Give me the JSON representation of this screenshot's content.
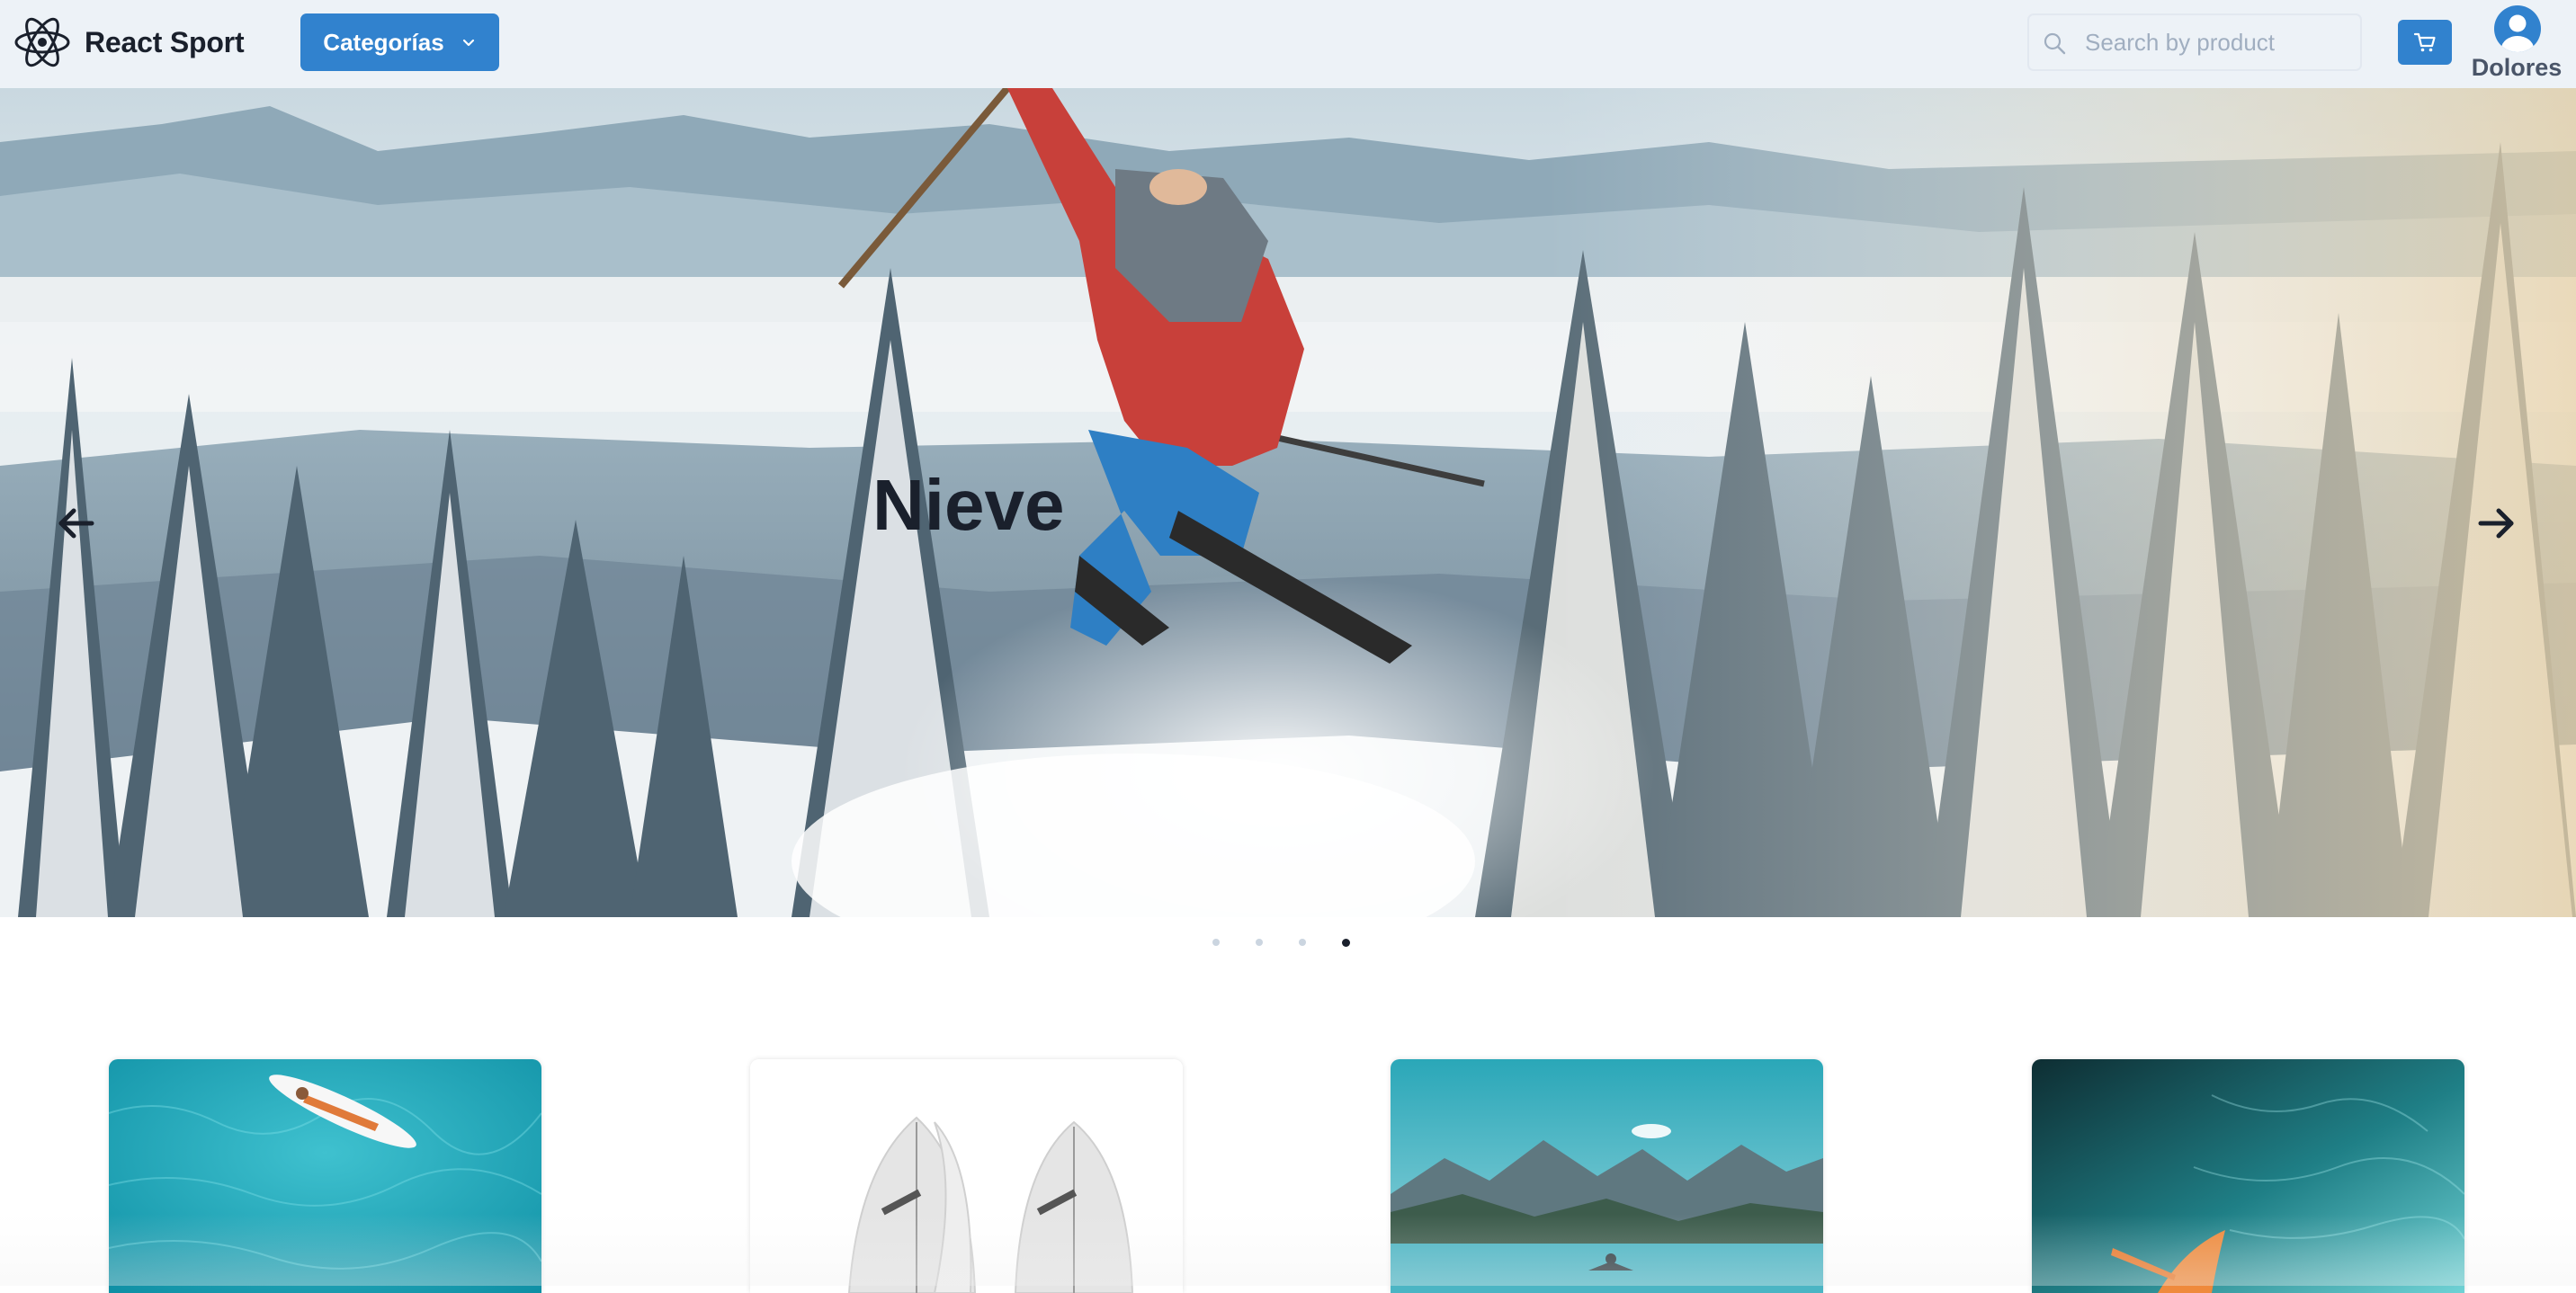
{
  "navbar": {
    "brand": {
      "name": "React Sport",
      "logo_icon": "react-atom-icon"
    },
    "categories_button": {
      "label": "Categorías",
      "icon": "chevron-down-icon"
    },
    "search": {
      "placeholder": "Search by product",
      "value": "",
      "icon": "search-icon"
    },
    "cart": {
      "icon": "cart-icon"
    },
    "user": {
      "name": "Dolores",
      "icon": "user-avatar-icon"
    }
  },
  "carousel": {
    "slide_title": "Nieve",
    "prev_icon": "arrow-left-icon",
    "next_icon": "arrow-right-icon",
    "slide_count": 4,
    "active_index": 3
  },
  "cards": [
    {
      "image": "surfer-on-turquoise-water"
    },
    {
      "image": "white-surfboards"
    },
    {
      "image": "mountain-lake-kayak"
    },
    {
      "image": "orange-kayak-on-water"
    }
  ],
  "colors": {
    "navbar_bg": "#edf2f7",
    "accent": "#3182ce",
    "text_dark": "#1a202c",
    "text_muted": "#4a5568"
  }
}
